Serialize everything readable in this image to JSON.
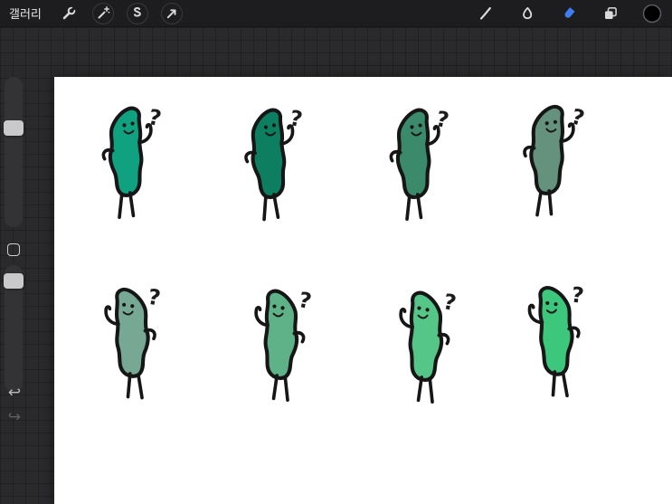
{
  "toolbar": {
    "gallery_label": "갤러리",
    "left_tools": [
      {
        "name": "actions-wrench-icon"
      },
      {
        "name": "adjustments-wand-icon"
      },
      {
        "name": "selection-s-icon"
      },
      {
        "name": "transform-arrow-icon"
      }
    ],
    "right_tools": [
      {
        "name": "paint-brush-icon"
      },
      {
        "name": "smudge-icon"
      },
      {
        "name": "eraser-icon",
        "active": true
      },
      {
        "name": "layers-icon"
      },
      {
        "name": "color-swatch"
      }
    ],
    "active_tool_color": "#3d7ef2",
    "icon_color": "#d9d9db",
    "current_color": "#000000"
  },
  "sidebar": {
    "controls": [
      "brush-size-slider",
      "modify-button",
      "opacity-slider",
      "undo-button",
      "redo-button"
    ],
    "undo_glyph": "↩",
    "redo_glyph": "↪"
  },
  "canvas": {
    "background": "#ffffff",
    "drawing": {
      "question_mark": "?",
      "outline_color": "#161616",
      "characters": [
        {
          "row": 1,
          "col": 1,
          "color": "#10A181"
        },
        {
          "row": 1,
          "col": 2,
          "color": "#0D7E60"
        },
        {
          "row": 1,
          "col": 3,
          "color": "#3A8A6B"
        },
        {
          "row": 1,
          "col": 4,
          "color": "#64927C"
        },
        {
          "row": 2,
          "col": 1,
          "color": "#76A893"
        },
        {
          "row": 2,
          "col": 2,
          "color": "#5FB287"
        },
        {
          "row": 2,
          "col": 3,
          "color": "#55C687"
        },
        {
          "row": 2,
          "col": 4,
          "color": "#3CC77C"
        }
      ]
    }
  }
}
